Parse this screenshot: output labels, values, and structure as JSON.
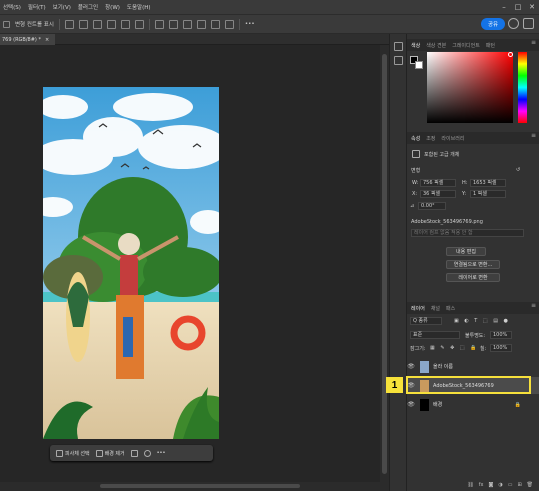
{
  "menu": [
    "선택(S)",
    "필터(T)",
    "보기(V)",
    "플러그인",
    "창(W)",
    "도움말(H)"
  ],
  "options": {
    "label": "변형 컨트롤 표시",
    "share_label": "공유"
  },
  "doc_tab": {
    "title": "769 (RGB/8#) *",
    "close": "×"
  },
  "context_bar": {
    "select_subject": "피사체 선택",
    "remove_bg": "배경 제거",
    "more": "•••"
  },
  "color_panel": {
    "tabs": [
      "색상",
      "색상 견본",
      "그레이디언트",
      "패턴"
    ],
    "foreground": "#000000",
    "background": "#ffffff"
  },
  "properties": {
    "tabs": [
      "속성",
      "조정",
      "라이브러리"
    ],
    "object_type": "포함된 고급 개체",
    "section": "변형",
    "w_label": "W:",
    "w_value": "756 픽셀",
    "h_label": "H:",
    "h_value": "1653 픽셀",
    "x_label": "X:",
    "x_value": "36 픽셀",
    "y_label": "Y:",
    "y_value": "1 픽셀",
    "angle_value": "0.00°",
    "filename": "AdobeStock_563496769.png",
    "path_placeholder": "레이어 컴프 없음 적용 안 함",
    "btn_edit": "내용 편집",
    "btn_convert_linked": "연결됨으로 변환...",
    "btn_convert_layers": "레이어로 변환"
  },
  "layers_panel": {
    "tabs": [
      "레이어",
      "채널",
      "패스"
    ],
    "filter_kind": "Q 종류",
    "blend_mode": "표준",
    "opacity_label": "불투명도:",
    "opacity_value": "100%",
    "lock_label": "잠그기:",
    "fill_label": "칠:",
    "fill_value": "100%",
    "layers": [
      {
        "name": "올라 이름",
        "visible": true
      },
      {
        "name": "AdobeStock_563496769",
        "visible": true,
        "selected": true
      },
      {
        "name": "배경",
        "visible": true,
        "locked": true
      }
    ],
    "footer_icons": [
      "link-icon",
      "fx-icon",
      "mask-icon",
      "adjust-icon",
      "group-icon",
      "new-layer-icon",
      "trash-icon"
    ],
    "fx_label": "fx"
  },
  "annotation": {
    "badge": "1",
    "highlight_color": "#f6e03c"
  }
}
